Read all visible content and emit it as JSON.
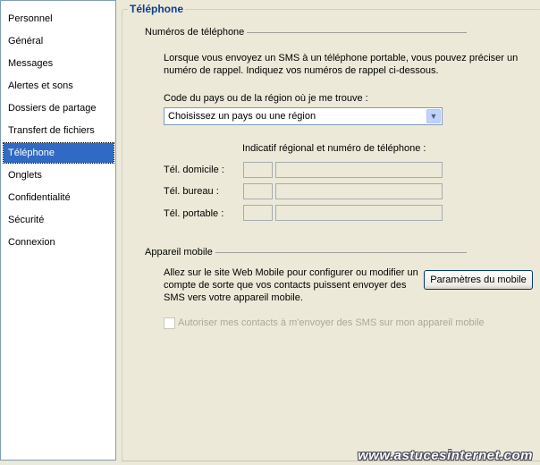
{
  "sidebar": {
    "items": [
      {
        "label": "Personnel"
      },
      {
        "label": "Général"
      },
      {
        "label": "Messages"
      },
      {
        "label": "Alertes et sons"
      },
      {
        "label": "Dossiers de partage"
      },
      {
        "label": "Transfert de fichiers"
      },
      {
        "label": "Téléphone",
        "selected": true
      },
      {
        "label": "Onglets"
      },
      {
        "label": "Confidentialité"
      },
      {
        "label": "Sécurité"
      },
      {
        "label": "Connexion"
      }
    ]
  },
  "main": {
    "title": "Téléphone",
    "phone_section": {
      "heading": "Numéros de téléphone",
      "description_line1": "Lorsque vous envoyez un SMS à un téléphone portable, vous pouvez préciser un",
      "description_line2": "numéro de rappel. Indiquez vos numéros de rappel ci-dessous.",
      "country_label": "Code du pays ou de la région où je me trouve :",
      "country_select": {
        "value": "Choisissez un pays ou une région"
      },
      "number_header": "Indicatif régional et numéro de téléphone :",
      "rows": [
        {
          "label": "Tél. domicile :",
          "area": "",
          "number": ""
        },
        {
          "label": "Tél. bureau :",
          "area": "",
          "number": ""
        },
        {
          "label": "Tél. portable :",
          "area": "",
          "number": ""
        }
      ]
    },
    "mobile_section": {
      "heading": "Appareil mobile",
      "description_line1": "Allez sur le site Web Mobile pour configurer ou modifier un",
      "description_line2": "compte de sorte que vos contacts puissent envoyer des",
      "description_line3": "SMS vers votre appareil mobile.",
      "button_label": "Paramètres du mobile",
      "checkbox_label": "Autoriser mes contacts à m'envoyer des SMS sur mon appareil mobile",
      "checkbox_checked": false,
      "checkbox_disabled": true
    }
  },
  "watermark": "www.astucesinternet.com"
}
